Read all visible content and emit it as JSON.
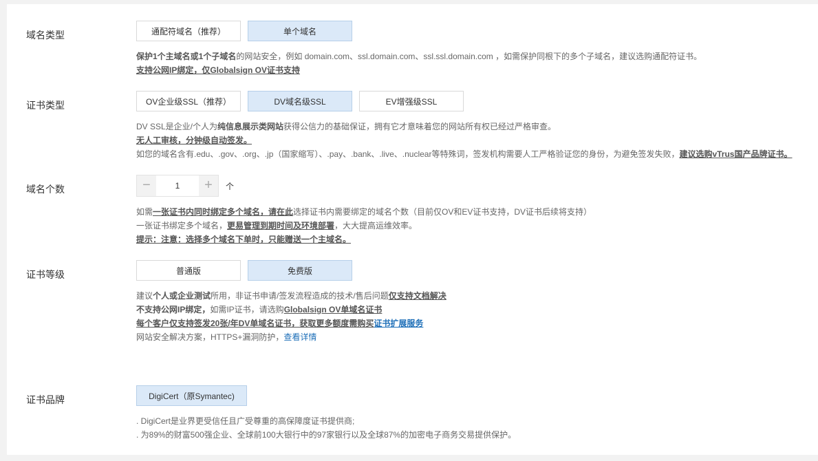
{
  "domain_type": {
    "label": "域名类型",
    "options": [
      "通配符域名（推荐）",
      "单个域名"
    ],
    "selected": "单个域名",
    "desc1_b1": "保护1个主域名或1个子域名",
    "desc1_t1": "的网站安全，例如 domain.com、ssl.domain.com、ssl.ssl.domain.com ，如需保护同根下的多个子域名，建议选购通配符证书。",
    "desc2": "支持公网IP绑定，仅Globalsign OV证书支持"
  },
  "cert_type": {
    "label": "证书类型",
    "options": [
      "OV企业级SSL（推荐）",
      "DV域名级SSL",
      "EV增强级SSL"
    ],
    "selected": "DV域名级SSL",
    "desc1_t1": "DV SSL是企业/个人为",
    "desc1_b1": "纯信息展示类网站",
    "desc1_t2": "获得公信力的基础保证，拥有它才意味着您的网站所有权已经过严格审查。",
    "desc2": "无人工审核，分钟级自动签发。",
    "desc3_t1": "如您的域名含有.edu、.gov、.org、.jp（国家缩写）、.pay、.bank、.live、.nuclear等特殊词，签发机构需要人工严格验证您的身份，为避免签发失败，",
    "desc3_b1": "建议选购vTrus国产品牌证书。"
  },
  "domain_count": {
    "label": "域名个数",
    "value": "1",
    "unit": "个",
    "minus": "−",
    "plus": "+",
    "desc1_t1": "如需",
    "desc1_b1": "一张证书内同时绑定多个域名，请在此",
    "desc1_t2": "选择证书内需要绑定的域名个数（目前仅OV和EV证书支持，DV证书后续将支持）",
    "desc2_t1": "一张证书绑定多个域名，",
    "desc2_b1": "更易管理到期时间及环境部署",
    "desc2_t2": "，大大提高运维效率。",
    "desc3": "提示：注意：选择多个域名下单时，只能赠送一个主域名。"
  },
  "cert_level": {
    "label": "证书等级",
    "options": [
      "普通版",
      "免费版"
    ],
    "selected": "免费版",
    "desc1_t1": "建议",
    "desc1_b1": "个人或企业测试",
    "desc1_t2": "所用，非证书申请/签发流程造成的技术/售后问题",
    "desc1_b2": "仅支持文档解决",
    "desc2_b1": "不支持公网IP绑定，",
    "desc2_t1": "如需IP证书，请选购",
    "desc2_b2": "Globalsign OV单域名证书",
    "desc3_b1": "每个客户仅支持签发20张/年DV单域名证书，获取更多额度需购买",
    "desc3_link": "证书扩展服务",
    "desc4_t1": "网站安全解决方案，HTTPS+漏洞防护，",
    "desc4_link": "查看详情"
  },
  "cert_brand": {
    "label": "证书品牌",
    "options": [
      "DigiCert（原Symantec)"
    ],
    "selected": "DigiCert（原Symantec)",
    "desc1": ". DigiCert是业界更受信任且广受尊重的高保障度证书提供商;",
    "desc2": ". 为89%的财富500强企业、全球前100大银行中的97家银行以及全球87%的加密电子商务交易提供保护。"
  }
}
